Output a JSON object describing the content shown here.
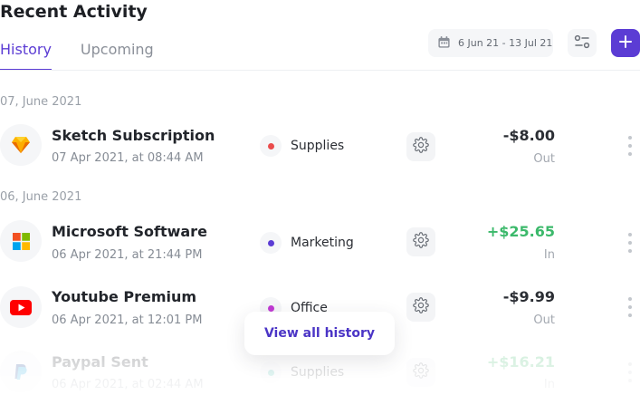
{
  "header": {
    "title": "Recent Activity"
  },
  "tabs": [
    {
      "label": "History"
    },
    {
      "label": "Upcoming"
    }
  ],
  "toolbar": {
    "date_range": "6 Jun 21 - 13 Jul 21",
    "add_label": "+"
  },
  "groups": [
    {
      "date": "07, June 2021"
    },
    {
      "date": "06, June 2021"
    }
  ],
  "transactions": [
    {
      "name": "Sketch Subscription",
      "datetime": "07 Apr 2021, at 08:44 AM",
      "category": "Supplies",
      "category_color": "#ea4c4c",
      "amount": "-$8.00",
      "flow": "Out",
      "logo_icon": "sketch-icon"
    },
    {
      "name": "Microsoft Software",
      "datetime": "06 Apr 2021, at 21:44 PM",
      "category": "Marketing",
      "category_color": "#5b3cd4",
      "amount": "+$25.65",
      "flow": "In",
      "logo_icon": "microsoft-icon"
    },
    {
      "name": "Youtube Premium",
      "datetime": "06 Apr 2021, at 12:01 PM",
      "category": "Office",
      "category_color": "#c13ad4",
      "amount": "-$9.99",
      "flow": "Out",
      "logo_icon": "youtube-icon"
    },
    {
      "name": "Paypal Sent",
      "datetime": "06 Apr 2021, at 02:44 AM",
      "category": "Supplies",
      "category_color": "#2fb5a3",
      "amount": "+$16.21",
      "flow": "In",
      "logo_icon": "paypal-icon"
    }
  ],
  "footer": {
    "view_all_label": "View all history"
  }
}
